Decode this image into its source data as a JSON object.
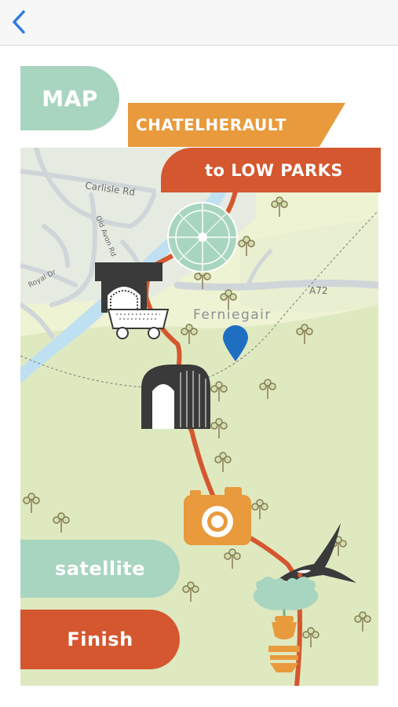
{
  "nav": {
    "back_icon": "chevron-left-icon"
  },
  "title": {
    "map": "MAP",
    "route_from": "CHATELHERAULT",
    "route_to": "to LOW PARKS"
  },
  "map": {
    "roads": [
      "Carlisle Rd",
      "Old Avon Rd",
      "Royal Dr",
      "A72"
    ],
    "place": "Ferniegair"
  },
  "buttons": {
    "satellite": "satellite",
    "finish": "Finish"
  },
  "colors": {
    "mint": "#a8d5bf",
    "orange": "#e89a3c",
    "rust": "#d4572f",
    "route": "#d4572f",
    "river": "#bfe0f0",
    "land": "#eef3d3",
    "pin": "#1e6fc2"
  },
  "icons": [
    "chatelherault-garden-icon",
    "viaduct-icon",
    "mine-cart-icon",
    "tunnel-icon",
    "camera-icon",
    "swallow-icon",
    "oak-leaf-icon",
    "acorn-icon",
    "location-pin-icon",
    "tree-icon"
  ]
}
